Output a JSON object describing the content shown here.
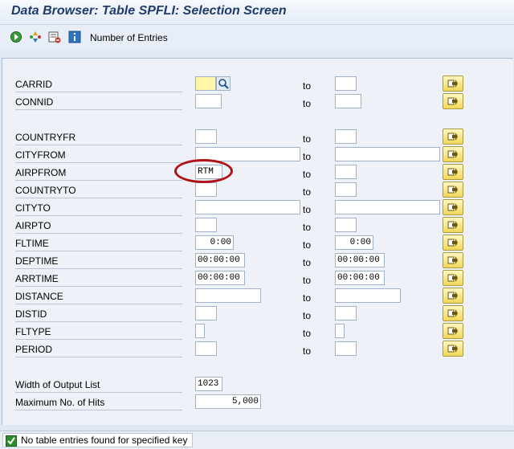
{
  "title": "Data Browser: Table SPFLI: Selection Screen",
  "toolbar": {
    "icons": [
      "execute-icon",
      "selection-options-icon",
      "delete-selection-icon",
      "info-icon"
    ],
    "number_of_entries": "Number of Entries"
  },
  "to_label": "to",
  "fields": [
    {
      "label": "CARRID",
      "low": "",
      "high": ""
    },
    {
      "label": "CONNID",
      "low": "",
      "high": ""
    },
    {
      "label": "COUNTRYFR",
      "low": "",
      "high": ""
    },
    {
      "label": "CITYFROM",
      "low": "",
      "high": ""
    },
    {
      "label": "AIRPFROM",
      "low": "RTM",
      "high": ""
    },
    {
      "label": "COUNTRYTO",
      "low": "",
      "high": ""
    },
    {
      "label": "CITYTO",
      "low": "",
      "high": ""
    },
    {
      "label": "AIRPTO",
      "low": "",
      "high": ""
    },
    {
      "label": "FLTIME",
      "low": "0:00",
      "high": "0:00"
    },
    {
      "label": "DEPTIME",
      "low": "00:00:00",
      "high": "00:00:00"
    },
    {
      "label": "ARRTIME",
      "low": "00:00:00",
      "high": "00:00:00"
    },
    {
      "label": "DISTANCE",
      "low": "",
      "high": ""
    },
    {
      "label": "DISTID",
      "low": "",
      "high": ""
    },
    {
      "label": "FLTYPE",
      "low": "",
      "high": ""
    },
    {
      "label": "PERIOD",
      "low": "",
      "high": ""
    }
  ],
  "output": {
    "width_label": "Width of Output List",
    "width_value": "1023",
    "max_hits_label": "Maximum No. of Hits",
    "max_hits_value": "5,000"
  },
  "status": {
    "icon": "check-icon",
    "message": "No table entries found for specified key"
  },
  "colors": {
    "highlight_circle": "#b11116",
    "active_field": "#fff6a8",
    "multiple_selection_button": "#f2d85a"
  }
}
